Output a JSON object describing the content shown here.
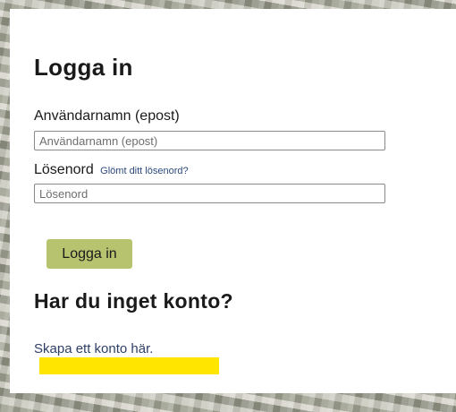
{
  "login": {
    "title": "Logga in",
    "username_label": "Användarnamn (epost)",
    "username_placeholder": "Användarnamn (epost)",
    "password_label": "Lösenord",
    "forgot_link": "Glömt ditt lösenord?",
    "password_placeholder": "Lösenord",
    "submit_label": "Logga in"
  },
  "signup": {
    "title": "Har du inget konto?",
    "create_link": "Skapa ett konto här."
  },
  "colors": {
    "button": "#b7c36f",
    "highlight": "#ffe500",
    "link": "#2d3f66"
  }
}
